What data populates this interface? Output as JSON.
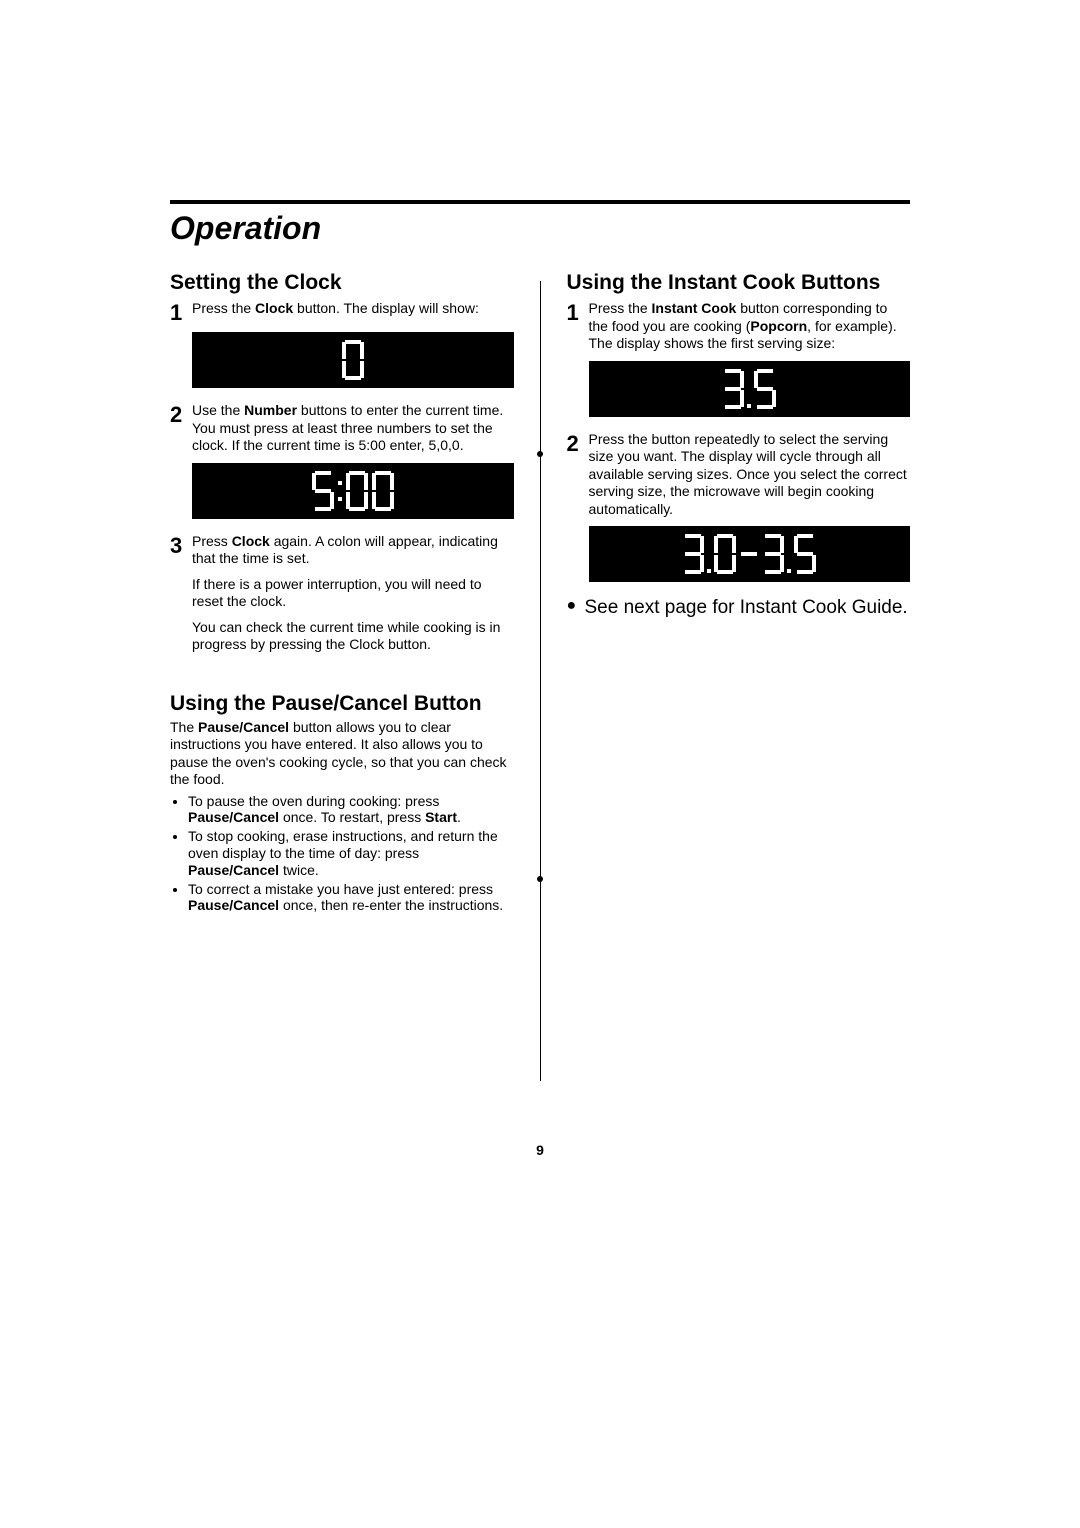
{
  "page": {
    "heading": "Operation",
    "page_number": "9"
  },
  "left": {
    "clock": {
      "heading": "Setting the Clock",
      "step1_parts": [
        "Press the ",
        "Clock",
        " button. The display will show:"
      ],
      "display1_value": "0",
      "step2_parts": [
        "Use the ",
        "Number",
        " buttons to enter the current time. You must press at least three numbers to set the clock. If the current time is 5:00 enter, 5,0,0."
      ],
      "display2_value": "5:00",
      "step3_p1_parts": [
        "Press ",
        "Clock",
        " again. A colon will appear, indicating that the time is set."
      ],
      "step3_p2": "If there is a power interruption, you will need to reset the clock.",
      "step3_p3": "You can check the current time while cooking is in progress by pressing the Clock  button."
    },
    "pause": {
      "heading": "Using the Pause/Cancel Button",
      "intro_parts": [
        "The ",
        "Pause/Cancel",
        " button allows you to clear instructions you have entered.  It also allows you to pause the oven's cooking cycle, so that you can check the food."
      ],
      "bullets": [
        {
          "parts": [
            "To pause the oven during cooking: press ",
            "Pause/Cancel",
            " once. To restart, press ",
            "Start",
            "."
          ]
        },
        {
          "parts": [
            "To stop cooking, erase instructions, and return the oven display to the time of day: press ",
            "Pause/Cancel",
            " twice."
          ]
        },
        {
          "parts": [
            "To correct a mistake you have just entered: press ",
            "Pause/Cancel",
            " once, then re-enter the instructions."
          ]
        }
      ]
    }
  },
  "right": {
    "instant": {
      "heading": "Using the Instant Cook Buttons",
      "step1_parts": [
        "Press the ",
        "Instant Cook",
        " button corresponding to the food you are cooking (",
        "Popcorn",
        ", for example). The display shows the first serving size:"
      ],
      "display1_value": "3.5",
      "step2": "Press the button repeatedly to select the serving size you want. The display will cycle through all available serving sizes. Once you select the correct serving size, the microwave will begin cooking automatically.",
      "display2_value": "3.0-3.5",
      "note": "See next page  for Instant Cook Guide."
    }
  }
}
